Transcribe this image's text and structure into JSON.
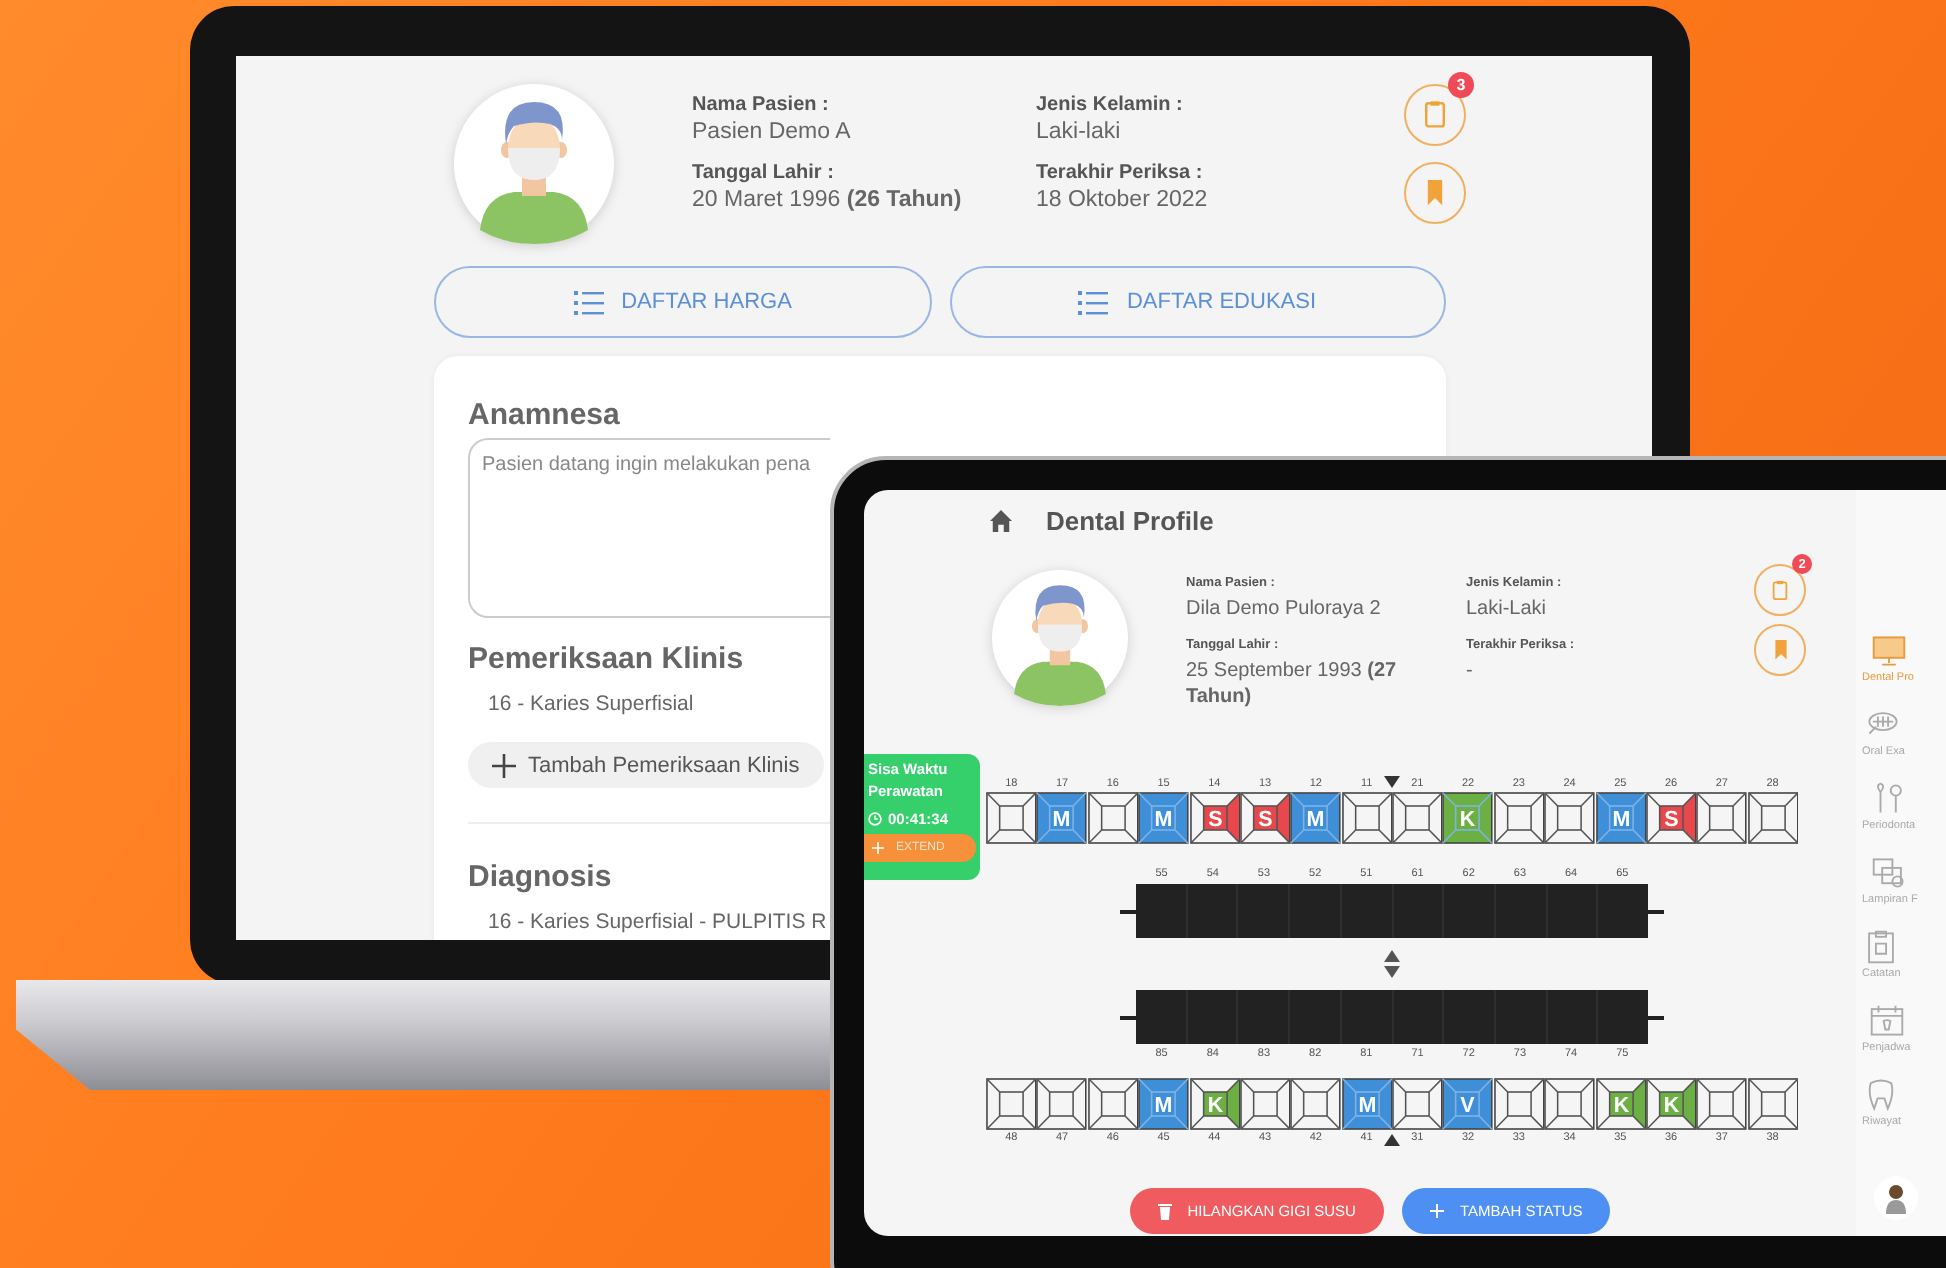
{
  "laptop": {
    "patient": {
      "fields": [
        {
          "label": "Nama Pasien :",
          "value": "Pasien Demo A"
        },
        {
          "label": "Jenis Kelamin :",
          "value": "Laki-laki"
        },
        {
          "label": "Tanggal Lahir :",
          "value": "20 Maret 1996 **(26 Tahun)**"
        },
        {
          "label": "Terakhir Periksa :",
          "value": "18 Oktober 2022"
        }
      ],
      "badge": "3"
    },
    "buttons": [
      "DAFTAR HARGA",
      "DAFTAR EDUKASI"
    ],
    "anamnesa": {
      "title": "Anamnesa",
      "value": "Pasien datang ingin melakukan pena"
    },
    "sections": [
      {
        "title": "Pemeriksaan Klinis",
        "items": [
          "16 - Karies Superfisial"
        ],
        "add_button": "Tambah Pemeriksaan Klinis"
      },
      {
        "title": "Diagnosis",
        "items": [
          "16 - Karies Superfisial - PULPITIS R"
        ]
      }
    ]
  },
  "tablet": {
    "title": "Dental Profile",
    "patient": {
      "fields": [
        {
          "label": "Nama Pasien :",
          "value": "Dila Demo Puloraya 2"
        },
        {
          "label": "Jenis Kelamin :",
          "value": "Laki-Laki"
        },
        {
          "label": "Tanggal Lahir :",
          "value": "25 September 1993 **(27 Tahun)**"
        },
        {
          "label": "Terakhir Periksa :",
          "value": "-"
        }
      ],
      "badge": "2"
    },
    "timer": {
      "title": "Sisa Waktu Perawatan",
      "time": "00:41:34",
      "extend": "EXTEND"
    },
    "upper_teeth": [
      {
        "number": "18",
        "kind": "empty"
      },
      {
        "number": "17",
        "kind": "full",
        "status": "M",
        "color": "#3f8fd8"
      },
      {
        "number": "16",
        "kind": "empty"
      },
      {
        "number": "15",
        "kind": "full",
        "status": "M",
        "color": "#3f8fd8"
      },
      {
        "number": "14",
        "kind": "side",
        "status": "S",
        "color": "#e8474c"
      },
      {
        "number": "13",
        "kind": "side",
        "status": "S",
        "color": "#e8474c"
      },
      {
        "number": "12",
        "kind": "full",
        "status": "M",
        "color": "#3f8fd8"
      },
      {
        "number": "11",
        "kind": "empty"
      },
      {
        "number": "21",
        "kind": "empty"
      },
      {
        "number": "22",
        "kind": "full",
        "status": "K",
        "color": "#6cb043"
      },
      {
        "number": "23",
        "kind": "empty"
      },
      {
        "number": "24",
        "kind": "empty"
      },
      {
        "number": "25",
        "kind": "full",
        "status": "M",
        "color": "#3f8fd8"
      },
      {
        "number": "26",
        "kind": "side",
        "status": "S",
        "color": "#e8474c"
      },
      {
        "number": "27",
        "kind": "empty"
      },
      {
        "number": "28",
        "kind": "empty"
      }
    ],
    "upper_milk_teeth": [
      "55",
      "54",
      "53",
      "52",
      "51",
      "61",
      "62",
      "63",
      "64",
      "65"
    ],
    "lower_milk_teeth": [
      "85",
      "84",
      "83",
      "82",
      "81",
      "71",
      "72",
      "73",
      "74",
      "75"
    ],
    "lower_teeth": [
      {
        "number": "48",
        "kind": "empty"
      },
      {
        "number": "47",
        "kind": "empty"
      },
      {
        "number": "46",
        "kind": "empty"
      },
      {
        "number": "45",
        "kind": "full",
        "status": "M",
        "color": "#3f8fd8"
      },
      {
        "number": "44",
        "kind": "side",
        "status": "K",
        "color": "#6cb043"
      },
      {
        "number": "43",
        "kind": "empty"
      },
      {
        "number": "42",
        "kind": "empty"
      },
      {
        "number": "41",
        "kind": "full",
        "status": "M",
        "color": "#3f8fd8"
      },
      {
        "number": "31",
        "kind": "empty"
      },
      {
        "number": "32",
        "kind": "full",
        "status": "V",
        "color": "#3f8fd8"
      },
      {
        "number": "33",
        "kind": "empty"
      },
      {
        "number": "34",
        "kind": "empty"
      },
      {
        "number": "35",
        "kind": "side",
        "status": "K",
        "color": "#6cb043"
      },
      {
        "number": "36",
        "kind": "side",
        "status": "K",
        "color": "#6cb043"
      },
      {
        "number": "37",
        "kind": "empty"
      },
      {
        "number": "38",
        "kind": "empty"
      }
    ],
    "buttons": [
      {
        "label": "HILANGKAN GIGI SUSU",
        "kind": "danger"
      },
      {
        "label": "TAMBAH STATUS",
        "kind": "primary"
      }
    ],
    "sidebar": [
      {
        "label": "Dental Pro",
        "selected": true
      },
      {
        "label": "Oral Exa",
        "selected": false
      },
      {
        "label": "Periodonta",
        "selected": false
      },
      {
        "label": "Lampiran F",
        "selected": false
      },
      {
        "label": "Catatan",
        "selected": false
      },
      {
        "label": "Penjadwa",
        "selected": false
      },
      {
        "label": "Riwayat",
        "selected": false
      }
    ]
  }
}
